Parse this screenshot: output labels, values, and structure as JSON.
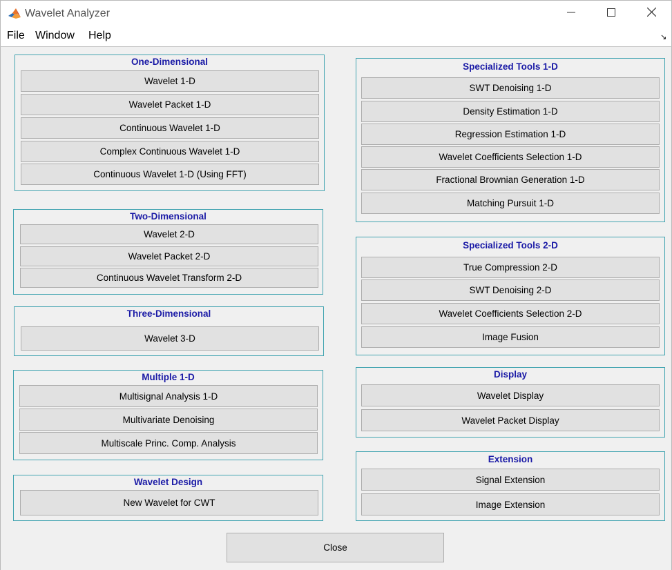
{
  "window": {
    "title": "Wavelet Analyzer"
  },
  "menu": {
    "items": [
      "File",
      "Window",
      "Help"
    ]
  },
  "icons": {
    "app": "matlab-icon",
    "minimize": "minimize-icon",
    "maximize": "maximize-icon",
    "close": "close-icon",
    "dock": "dock-arrow-icon"
  },
  "colors": {
    "panel_border": "#40a3b0",
    "panel_title": "#1a1aa6",
    "button_bg": "#e1e1e1"
  },
  "panels": {
    "one_d": {
      "title": "One-Dimensional",
      "buttons": [
        "Wavelet 1-D",
        "Wavelet Packet 1-D",
        "Continuous Wavelet 1-D",
        "Complex Continuous Wavelet 1-D",
        "Continuous Wavelet 1-D (Using FFT)"
      ]
    },
    "two_d": {
      "title": "Two-Dimensional",
      "buttons": [
        "Wavelet 2-D",
        "Wavelet Packet 2-D",
        "Continuous Wavelet Transform 2-D"
      ]
    },
    "three_d": {
      "title": "Three-Dimensional",
      "buttons": [
        "Wavelet 3-D"
      ]
    },
    "multi_1d": {
      "title": "Multiple 1-D",
      "buttons": [
        "Multisignal Analysis 1-D",
        "Multivariate Denoising",
        "Multiscale Princ. Comp. Analysis"
      ]
    },
    "design": {
      "title": "Wavelet Design",
      "buttons": [
        "New Wavelet for CWT"
      ]
    },
    "spec_1d": {
      "title": "Specialized Tools 1-D",
      "buttons": [
        "SWT Denoising 1-D",
        "Density Estimation 1-D",
        "Regression Estimation 1-D",
        "Wavelet Coefficients Selection 1-D",
        "Fractional Brownian Generation 1-D",
        "Matching Pursuit 1-D"
      ]
    },
    "spec_2d": {
      "title": "Specialized Tools 2-D",
      "buttons": [
        "True Compression 2-D",
        "SWT Denoising 2-D",
        "Wavelet Coefficients Selection 2-D",
        "Image Fusion"
      ]
    },
    "display": {
      "title": "Display",
      "buttons": [
        "Wavelet Display",
        "Wavelet Packet Display"
      ]
    },
    "extension": {
      "title": "Extension",
      "buttons": [
        "Signal Extension",
        "Image Extension"
      ]
    }
  },
  "footer": {
    "close_label": "Close"
  }
}
